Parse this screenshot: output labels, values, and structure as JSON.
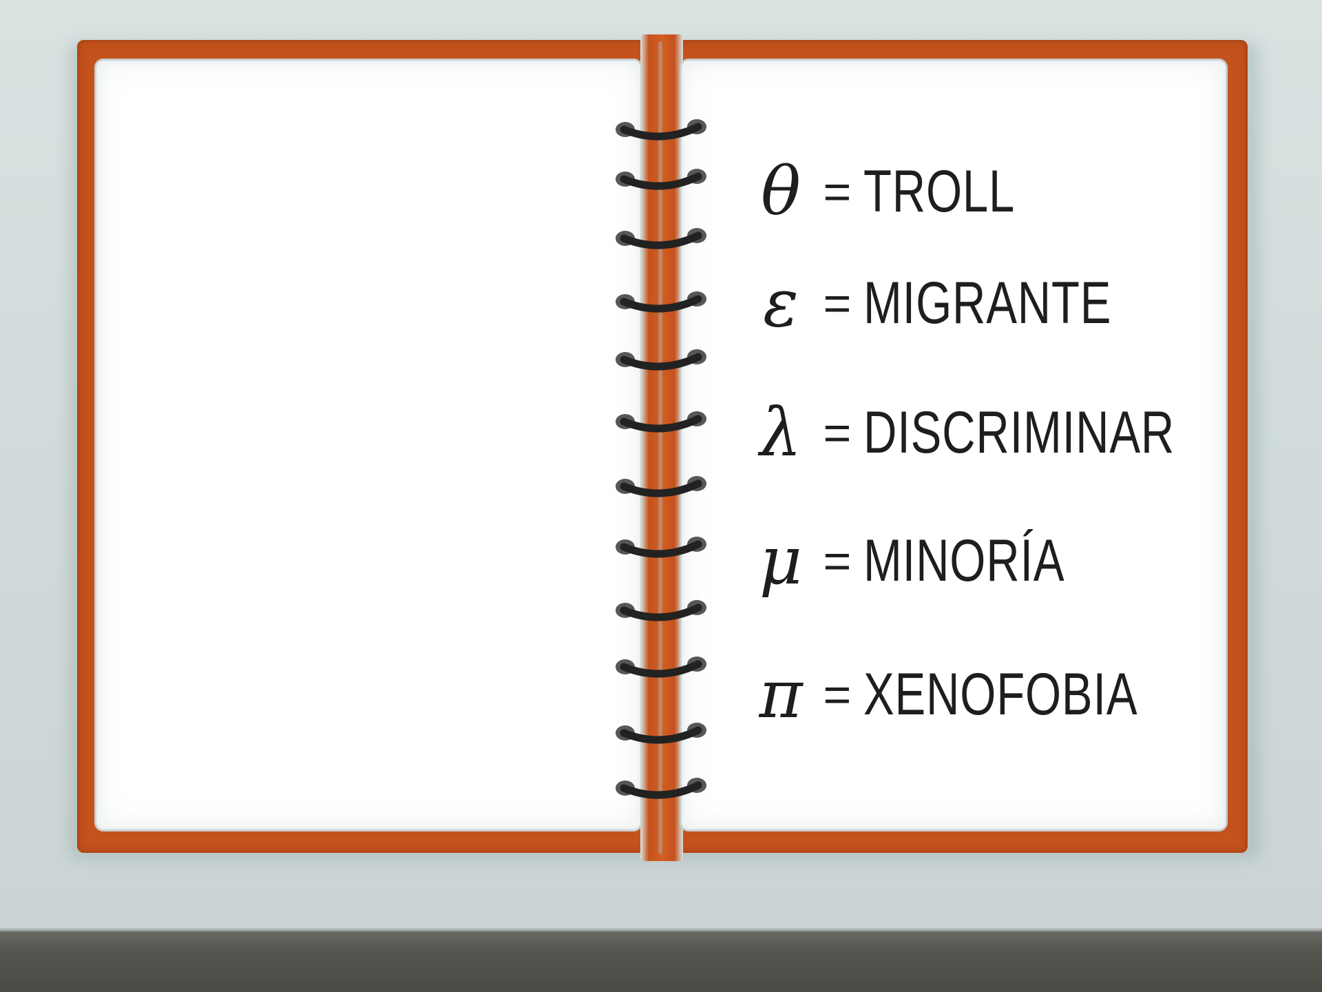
{
  "glossary": {
    "entries": [
      {
        "symbol": "θ",
        "equals": "=",
        "word": "TROLL"
      },
      {
        "symbol": "ε",
        "equals": "=",
        "word": "MIGRANTE"
      },
      {
        "symbol": "λ",
        "equals": "=",
        "word": "DISCRIMINAR"
      },
      {
        "symbol": "μ",
        "equals": "=",
        "word": "MINORÍA"
      },
      {
        "symbol": "π",
        "equals": "=",
        "word": "XENOFOBIA"
      }
    ]
  },
  "colors": {
    "cover": "#c4521c",
    "page": "#ffffff",
    "wall": "#d2dcdc",
    "floor": "#55554f",
    "ink": "#1e1e1e",
    "ring": "#222222"
  },
  "icons": {
    "binding": "spiral-binding-rings"
  }
}
